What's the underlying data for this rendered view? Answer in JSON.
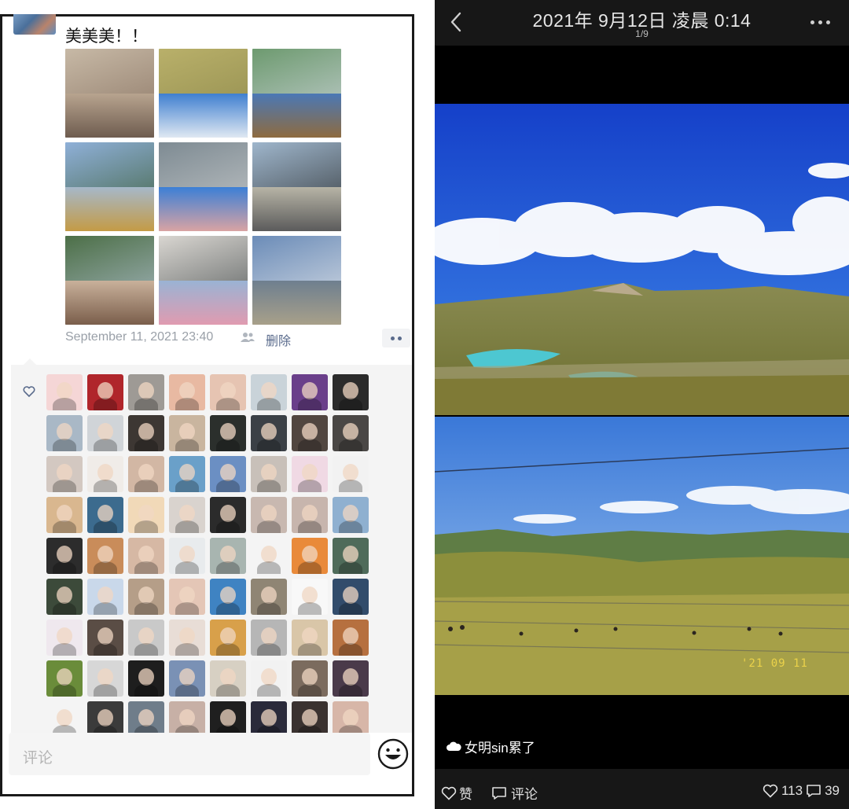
{
  "post": {
    "text": "美美美！！",
    "timestamp": "September 11, 2021 23:40",
    "delete_label": "删除",
    "photos": [
      {
        "top": "#c7b9a6",
        "top2": "#8a7463",
        "bot": "#b8a48f",
        "bot2": "#6e5c4f"
      },
      {
        "top": "#b9b06a",
        "top2": "#8f8a4c",
        "bot": "#3f7fd0",
        "bot2": "#dfe8f2"
      },
      {
        "top": "#6d9a6f",
        "top2": "#cbd3d8",
        "bot": "#4b78b5",
        "bot2": "#8e6b3f"
      },
      {
        "top": "#8fb0d8",
        "top2": "#3d5e3a",
        "bot": "#a6b8c9",
        "bot2": "#c49b45"
      },
      {
        "top": "#7e8b93",
        "top2": "#c6c9ca",
        "bot": "#3c7fd6",
        "bot2": "#d9a3a3"
      },
      {
        "top": "#9fb6cc",
        "top2": "#303436",
        "bot": "#b7b4a6",
        "bot2": "#5b5b5b"
      },
      {
        "top": "#4c6f47",
        "top2": "#aebdca",
        "bot": "#c9b19b",
        "bot2": "#7a5e4b"
      },
      {
        "top": "#d9d6d1",
        "top2": "#4f5556",
        "bot": "#9ab3d4",
        "bot2": "#e09bb0"
      },
      {
        "top": "#6b8cb8",
        "top2": "#dfe3e8",
        "bot": "#6e7f8f",
        "bot2": "#a8a08a"
      }
    ]
  },
  "likers": [
    "#f5d6d6",
    "#b0262b",
    "#9e9a95",
    "#e8b9a2",
    "#e6c4b2",
    "#c9d3d9",
    "#6a3f8a",
    "#2b2b2b",
    "#a9b8c6",
    "#d0d4d8",
    "#3d3733",
    "#c9b59f",
    "#2b2f2c",
    "#3b4046",
    "#514640",
    "#4a4745",
    "#d3c8c1",
    "#f0ece8",
    "#d2b7a4",
    "#6aa0c9",
    "#6b8fc3",
    "#c8c0b9",
    "#f0d9e4",
    "#f2f2f2",
    "#d9b78f",
    "#3c6b8e",
    "#f1d9b8",
    "#d9d3ce",
    "#2b2b2b",
    "#c8b8b0",
    "#c7b5ad",
    "#8fb0d0",
    "#2c2c2c",
    "#c98c5a",
    "#d6b8a4",
    "#e8ebed",
    "#a8b5b0",
    "#f4f4f4",
    "#e98a3a",
    "#4f6b5a",
    "#3c4a3a",
    "#c9d8ea",
    "#b59e88",
    "#e4c6b6",
    "#3f83c2",
    "#8f8574",
    "#f8f8f8",
    "#324c6b",
    "#efe8ee",
    "#5a4d45",
    "#c9c9c9",
    "#e8ddd6",
    "#d8a04a",
    "#b6b6b6",
    "#d9c6a8",
    "#b6703f",
    "#6a8c3a",
    "#d7d7d7",
    "#1e1e1e",
    "#7a91b5",
    "#d7d0c3",
    "#f2f2f2",
    "#7b6b5e",
    "#4a3a4a",
    "#f4f4f4",
    "#3b3b3b",
    "#6f7d8a",
    "#c7b0a6",
    "#1f1f1f",
    "#2a2a3a",
    "#3a3230",
    "#d7b6a8"
  ],
  "comment": {
    "placeholder": "评论"
  },
  "viewer": {
    "title": "2021年 9月12日 凌晨 0:14",
    "counter": "1/9",
    "datestamp": "'21 09 11",
    "caption": "女明sin累了",
    "like_label": "赞",
    "comment_label": "评论",
    "likes_count": "113",
    "comments_count": "39"
  },
  "colors": {
    "sky_deep": "#1a4fd8",
    "sky_light": "#4f8ee6",
    "grass": "#8c8f3c",
    "lake": "#4dc7d1",
    "link": "#5a6b8c",
    "meta_gray": "#9aa0a8"
  }
}
